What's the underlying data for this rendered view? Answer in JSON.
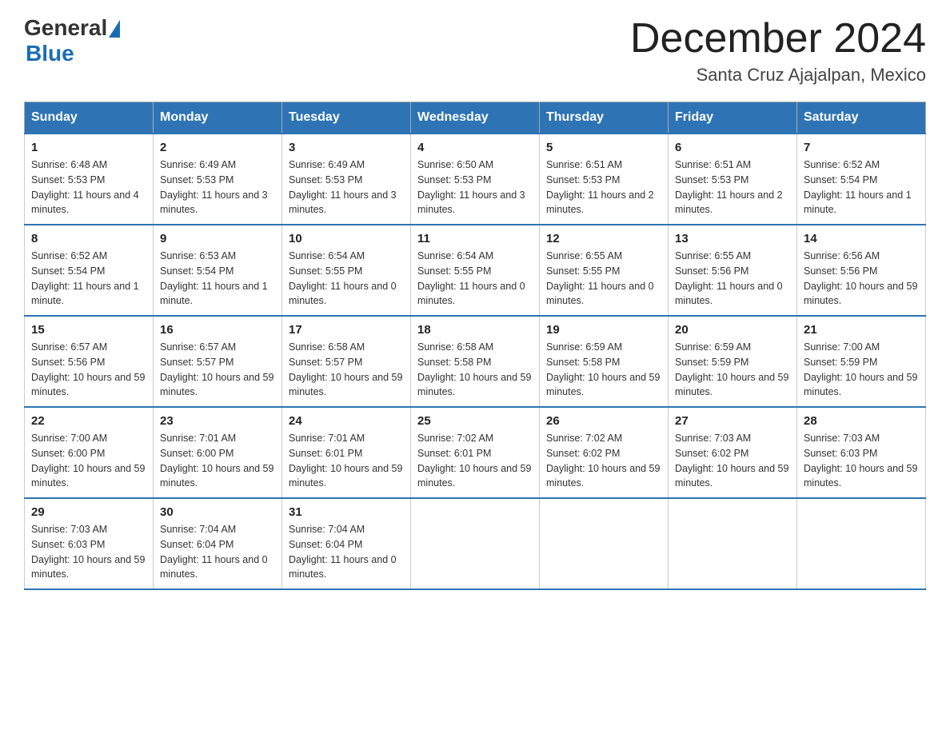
{
  "header": {
    "logo_line1": "General",
    "logo_line2": "Blue",
    "title": "December 2024",
    "subtitle": "Santa Cruz Ajajalpan, Mexico"
  },
  "weekdays": [
    "Sunday",
    "Monday",
    "Tuesday",
    "Wednesday",
    "Thursday",
    "Friday",
    "Saturday"
  ],
  "weeks": [
    [
      {
        "day": "1",
        "sunrise": "6:48 AM",
        "sunset": "5:53 PM",
        "daylight": "11 hours and 4 minutes."
      },
      {
        "day": "2",
        "sunrise": "6:49 AM",
        "sunset": "5:53 PM",
        "daylight": "11 hours and 3 minutes."
      },
      {
        "day": "3",
        "sunrise": "6:49 AM",
        "sunset": "5:53 PM",
        "daylight": "11 hours and 3 minutes."
      },
      {
        "day": "4",
        "sunrise": "6:50 AM",
        "sunset": "5:53 PM",
        "daylight": "11 hours and 3 minutes."
      },
      {
        "day": "5",
        "sunrise": "6:51 AM",
        "sunset": "5:53 PM",
        "daylight": "11 hours and 2 minutes."
      },
      {
        "day": "6",
        "sunrise": "6:51 AM",
        "sunset": "5:53 PM",
        "daylight": "11 hours and 2 minutes."
      },
      {
        "day": "7",
        "sunrise": "6:52 AM",
        "sunset": "5:54 PM",
        "daylight": "11 hours and 1 minute."
      }
    ],
    [
      {
        "day": "8",
        "sunrise": "6:52 AM",
        "sunset": "5:54 PM",
        "daylight": "11 hours and 1 minute."
      },
      {
        "day": "9",
        "sunrise": "6:53 AM",
        "sunset": "5:54 PM",
        "daylight": "11 hours and 1 minute."
      },
      {
        "day": "10",
        "sunrise": "6:54 AM",
        "sunset": "5:55 PM",
        "daylight": "11 hours and 0 minutes."
      },
      {
        "day": "11",
        "sunrise": "6:54 AM",
        "sunset": "5:55 PM",
        "daylight": "11 hours and 0 minutes."
      },
      {
        "day": "12",
        "sunrise": "6:55 AM",
        "sunset": "5:55 PM",
        "daylight": "11 hours and 0 minutes."
      },
      {
        "day": "13",
        "sunrise": "6:55 AM",
        "sunset": "5:56 PM",
        "daylight": "11 hours and 0 minutes."
      },
      {
        "day": "14",
        "sunrise": "6:56 AM",
        "sunset": "5:56 PM",
        "daylight": "10 hours and 59 minutes."
      }
    ],
    [
      {
        "day": "15",
        "sunrise": "6:57 AM",
        "sunset": "5:56 PM",
        "daylight": "10 hours and 59 minutes."
      },
      {
        "day": "16",
        "sunrise": "6:57 AM",
        "sunset": "5:57 PM",
        "daylight": "10 hours and 59 minutes."
      },
      {
        "day": "17",
        "sunrise": "6:58 AM",
        "sunset": "5:57 PM",
        "daylight": "10 hours and 59 minutes."
      },
      {
        "day": "18",
        "sunrise": "6:58 AM",
        "sunset": "5:58 PM",
        "daylight": "10 hours and 59 minutes."
      },
      {
        "day": "19",
        "sunrise": "6:59 AM",
        "sunset": "5:58 PM",
        "daylight": "10 hours and 59 minutes."
      },
      {
        "day": "20",
        "sunrise": "6:59 AM",
        "sunset": "5:59 PM",
        "daylight": "10 hours and 59 minutes."
      },
      {
        "day": "21",
        "sunrise": "7:00 AM",
        "sunset": "5:59 PM",
        "daylight": "10 hours and 59 minutes."
      }
    ],
    [
      {
        "day": "22",
        "sunrise": "7:00 AM",
        "sunset": "6:00 PM",
        "daylight": "10 hours and 59 minutes."
      },
      {
        "day": "23",
        "sunrise": "7:01 AM",
        "sunset": "6:00 PM",
        "daylight": "10 hours and 59 minutes."
      },
      {
        "day": "24",
        "sunrise": "7:01 AM",
        "sunset": "6:01 PM",
        "daylight": "10 hours and 59 minutes."
      },
      {
        "day": "25",
        "sunrise": "7:02 AM",
        "sunset": "6:01 PM",
        "daylight": "10 hours and 59 minutes."
      },
      {
        "day": "26",
        "sunrise": "7:02 AM",
        "sunset": "6:02 PM",
        "daylight": "10 hours and 59 minutes."
      },
      {
        "day": "27",
        "sunrise": "7:03 AM",
        "sunset": "6:02 PM",
        "daylight": "10 hours and 59 minutes."
      },
      {
        "day": "28",
        "sunrise": "7:03 AM",
        "sunset": "6:03 PM",
        "daylight": "10 hours and 59 minutes."
      }
    ],
    [
      {
        "day": "29",
        "sunrise": "7:03 AM",
        "sunset": "6:03 PM",
        "daylight": "10 hours and 59 minutes."
      },
      {
        "day": "30",
        "sunrise": "7:04 AM",
        "sunset": "6:04 PM",
        "daylight": "11 hours and 0 minutes."
      },
      {
        "day": "31",
        "sunrise": "7:04 AM",
        "sunset": "6:04 PM",
        "daylight": "11 hours and 0 minutes."
      },
      null,
      null,
      null,
      null
    ]
  ]
}
